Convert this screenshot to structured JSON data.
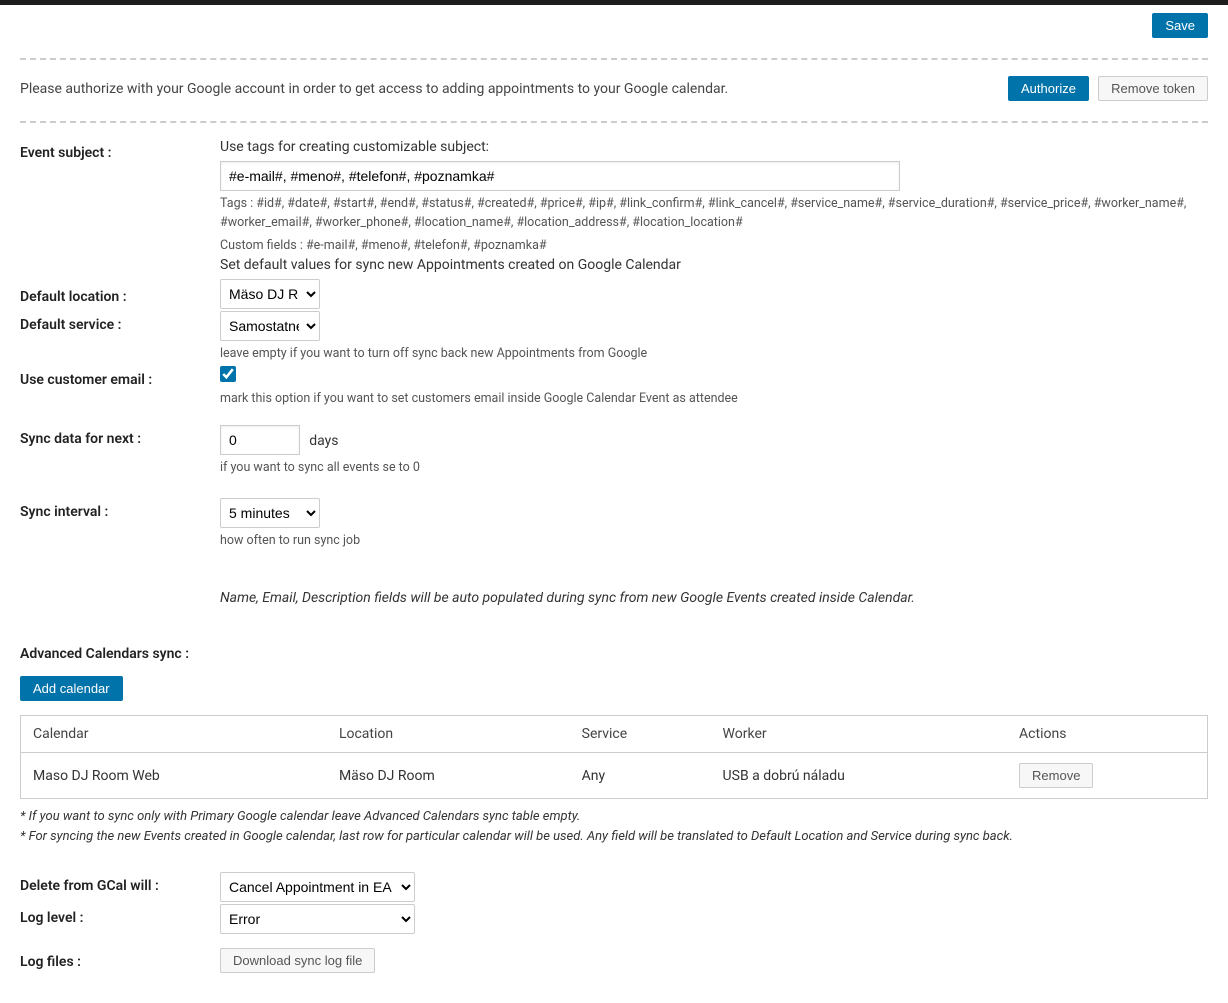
{
  "top": {
    "save": "Save"
  },
  "auth": {
    "message": "Please authorize with your Google account in order to get access to adding appointments to your Google calendar.",
    "authorize": "Authorize",
    "remove_token": "Remove token"
  },
  "event_subject": {
    "label": "Event subject :",
    "intro": "Use tags for creating customizable subject:",
    "value": "#e-mail#, #meno#, #telefon#, #poznamka#",
    "tags_line": "Tags : #id#, #date#, #start#, #end#, #status#, #created#, #price#, #ip#, #link_confirm#, #link_cancel#, #service_name#, #service_duration#, #service_price#, #worker_name#, #worker_email#, #worker_phone#, #location_name#, #location_address#, #location_location#",
    "custom_fields_line": "Custom fields : #e-mail#, #meno#, #telefon#, #poznamka#"
  },
  "default_location": {
    "label": "Default location :",
    "intro": "Set default values for sync new Appointments created on Google Calendar",
    "selected": "Mäso DJ Ro"
  },
  "default_service": {
    "label": "Default service :",
    "selected": "Samostatné",
    "help": "leave empty if you want to turn off sync back new Appointments from Google"
  },
  "use_customer_email": {
    "label": "Use customer email :",
    "checked": true,
    "help": "mark this option if you want to set customers email inside Google Calendar Event as attendee"
  },
  "sync_next": {
    "label": "Sync data for next :",
    "value": "0",
    "suffix": "days",
    "help": "if you want to sync all events se to 0"
  },
  "sync_interval": {
    "label": "Sync interval :",
    "selected": "5 minutes",
    "help": "how often to run sync job"
  },
  "auto_populate_note": "Name, Email, Description fields will be auto populated during sync from new Google Events created inside Calendar.",
  "advanced": {
    "label": "Advanced Calendars sync :",
    "add_button": "Add calendar",
    "headers": {
      "calendar": "Calendar",
      "location": "Location",
      "service": "Service",
      "worker": "Worker",
      "actions": "Actions"
    },
    "rows": [
      {
        "calendar": "Maso DJ Room Web",
        "location": "Mäso DJ Room",
        "service": "Any",
        "worker": "USB a dobrú náladu",
        "remove": "Remove"
      }
    ],
    "footnote1": "* If you want to sync only with Primary Google calendar leave Advanced Calendars sync table empty.",
    "footnote2": "* For syncing the new Events created in Google calendar, last row for particular calendar will be used. Any field will be translated to Default Location and Service during sync back."
  },
  "delete_gcal": {
    "label": "Delete from GCal will :",
    "selected": "Cancel Appointment in EA"
  },
  "log_level": {
    "label": "Log level :",
    "selected": "Error"
  },
  "log_files": {
    "label": "Log files :",
    "button": "Download sync log file"
  }
}
